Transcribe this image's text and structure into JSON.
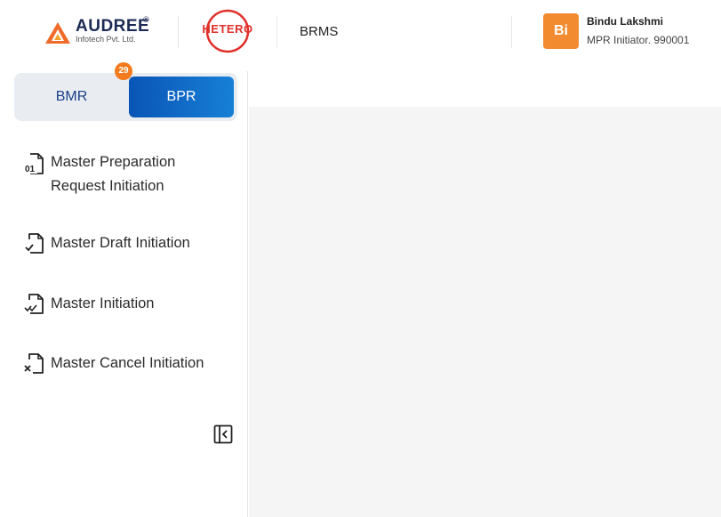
{
  "header": {
    "audree_logo": {
      "name": "AUDREE",
      "registered": "®",
      "subtitle": "Infotech Pvt. Ltd."
    },
    "hetero_logo": {
      "name": "HETERO"
    },
    "app_name": "BRMS",
    "user": {
      "initials": "Bi",
      "name": "Bindu Lakshmi",
      "role": "MPR Initiator. 990001",
      "avatar_color": "#f28b30"
    }
  },
  "sidebar": {
    "toggle": {
      "options": [
        {
          "label": "BMR",
          "active": false
        },
        {
          "label": "BPR",
          "active": true
        }
      ],
      "badge": "29",
      "active_color": "#0a55b5",
      "badge_color": "#f37b1d"
    },
    "menu": [
      {
        "label_lines": [
          "Master Preparation",
          "Request Initiation"
        ],
        "icon": "document-01-icon"
      },
      {
        "label": "Master Draft Initiation",
        "icon": "document-check-icon"
      },
      {
        "label": "Master Initiation",
        "icon": "document-double-check-icon"
      },
      {
        "label": "Master Cancel Initiation",
        "icon": "document-cancel-icon"
      }
    ],
    "collapse_icon": "collapse-sidebar-icon"
  }
}
